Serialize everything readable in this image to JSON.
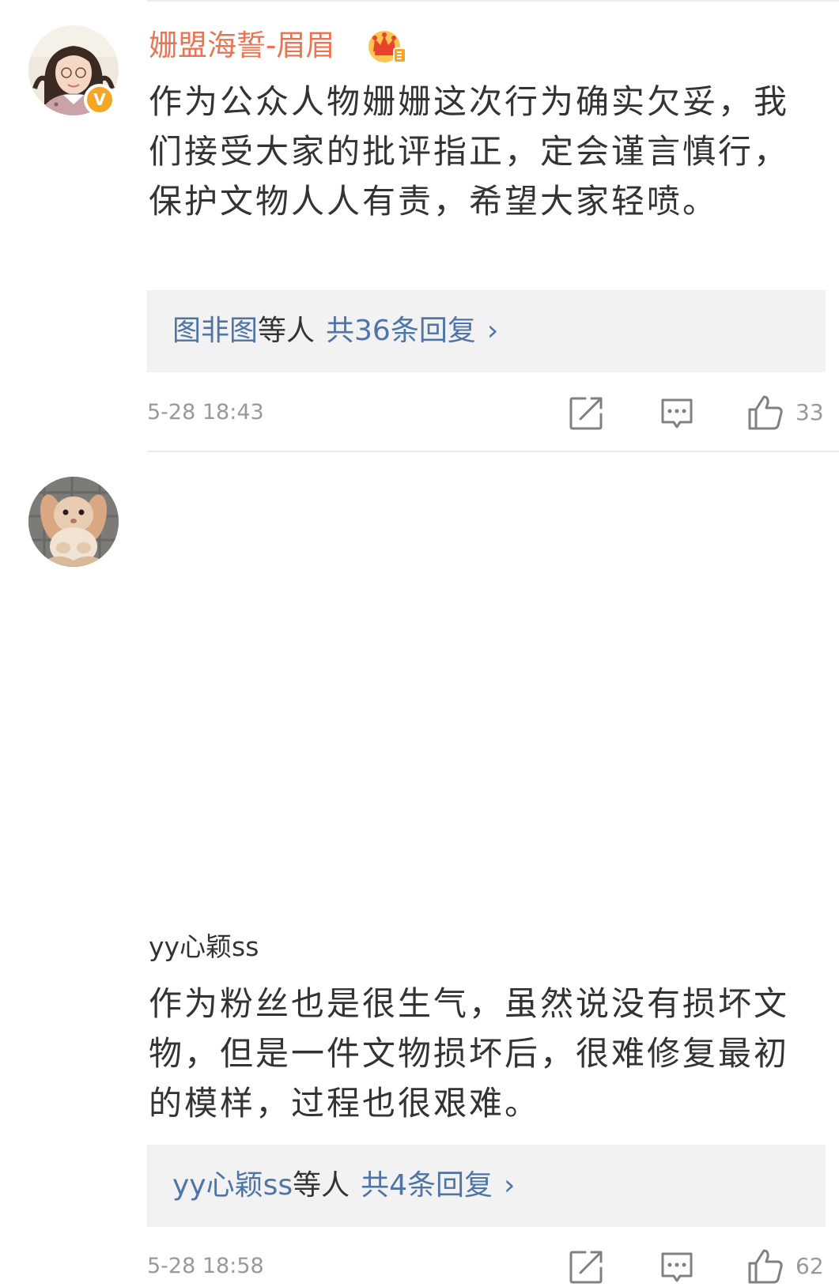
{
  "comments": [
    {
      "username": "姗盟海誓-眉眉",
      "username_color": "#eb7350",
      "text": "作为公众人物姗姗这次行为确实欠妥，我们接受大家的批评指正，定会谨言慎行，保护文物人人有责，希望大家轻喷。",
      "reply_users": "图非图",
      "reply_etc": "等人",
      "reply_count": "共36条回复",
      "reply_arrow": "›",
      "timestamp": "5-28 18:43",
      "likes": "33",
      "verified_badge": "V",
      "icons": [
        "avatar-girl-photo",
        "verified-badge-icon",
        "crown-member-icon",
        "repost-icon",
        "comment-icon",
        "thumbs-up-icon"
      ]
    },
    {
      "username": "yy心颖ss",
      "username_color": "#333333",
      "text": "作为粉丝也是很生气，虽然说没有损坏文物，但是一件文物损坏后，很难修复最初的模样，过程也很艰难。",
      "reply_users": "yy心颖ss",
      "reply_etc": "等人",
      "reply_count": "共4条回复",
      "reply_arrow": "›",
      "timestamp": "5-28 18:58",
      "likes": "62",
      "icons": [
        "avatar-rabbit-photo",
        "repost-icon",
        "comment-icon",
        "thumbs-up-icon"
      ]
    }
  ],
  "colors": {
    "link_blue": "#4e74a8",
    "reply_bg": "#f2f2f2",
    "meta_gray": "#999999",
    "text": "#333333",
    "badge_orange": "#f6a623"
  }
}
